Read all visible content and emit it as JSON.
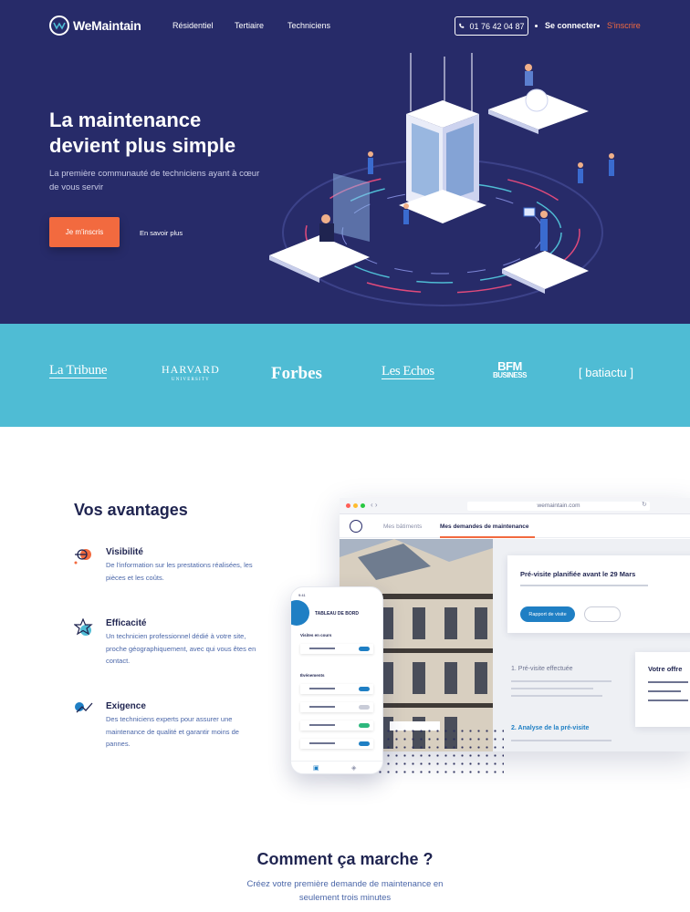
{
  "nav": {
    "brand": "WeMaintain",
    "links": [
      "Résidentiel",
      "Tertiaire",
      "Techniciens"
    ],
    "phone": "01 76 42 04 87",
    "login": "Se connecter",
    "signup": "S'inscrire"
  },
  "hero": {
    "title_line1": "La maintenance",
    "title_line2": "devient plus simple",
    "subtitle": "La première communauté de techniciens ayant à cœur de vous servir",
    "cta": "Je m'inscris",
    "learn_more": "En savoir plus"
  },
  "press": {
    "logos": [
      "La Tribune",
      "HARVARD",
      "UNIVERSITY",
      "Forbes",
      "Les Echos",
      "BFM",
      "BUSINESS",
      "[ batiactu ]"
    ]
  },
  "advantages": {
    "title": "Vos avantages",
    "items": [
      {
        "name": "Visibilité",
        "desc": "De l'information sur les prestations réalisées, les pièces et les coûts.",
        "icon": "target-icon"
      },
      {
        "name": "Efficacité",
        "desc": "Un technicien professionnel dédié à votre site, proche géographiquement, avec qui vous êtes en contact.",
        "icon": "star-icon"
      },
      {
        "name": "Exigence",
        "desc": "Des techniciens experts pour assurer une maintenance de qualité et garantir moins de pannes.",
        "icon": "check-icon"
      }
    ]
  },
  "browser": {
    "url": "wemaintain.com",
    "tab1": "Mes bâtiments",
    "tab2": "Mes demandes de maintenance",
    "card_title": "Pré-visite planifiée avant le 29 Mars",
    "report_button": "Rapport de visite",
    "step1": "1. Pré-visite effectuée",
    "step2": "2. Analyse de la pré-visite",
    "offer": "Votre offre"
  },
  "phone_app": {
    "status_time": "9:41",
    "title": "TABLEAU DE BORD",
    "section1": "Visites en cours",
    "section2": "Événements"
  },
  "how": {
    "title": "Comment ça marche ?",
    "subtitle": "Créez votre première demande de maintenance en seulement trois minutes"
  },
  "colors": {
    "hero_bg": "#272b69",
    "accent_orange": "#f26a3f",
    "press_bg": "#4fbcd4",
    "link_blue": "#1f7fc4"
  }
}
